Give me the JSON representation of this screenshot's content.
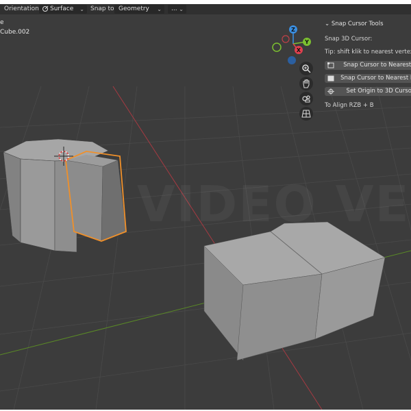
{
  "header": {
    "orientation_label": "Orientation:",
    "orientation_value": "Surface",
    "snap_label": "Snap to:",
    "snap_value": "Geometry",
    "extra_value": "..."
  },
  "viewport": {
    "object_info_1": "e",
    "object_info_2": "Cube.002",
    "watermark": "VIDEO VERSION"
  },
  "panel": {
    "title": "Snap Cursor Tools",
    "subtitle": "Snap 3D Cursor:",
    "tip": "Tip: shift klik to nearest vertex o",
    "buttons": [
      {
        "label": "Snap Cursor to Nearest V",
        "icon": "vertex-icon"
      },
      {
        "label": "Snap Cursor to Nearest Fac",
        "icon": "face-icon"
      },
      {
        "label": "Set Origin to 3D Cursor",
        "icon": "cursor-icon"
      }
    ],
    "footer": "To Align RZB + B"
  },
  "gizmo": {
    "x_label": "X",
    "y_label": "Y",
    "z_label": "Z"
  },
  "colors": {
    "viewport_bg": "#3c3c3c",
    "selection_outline": "#f0902a",
    "x_axis": "#e0404e",
    "y_axis": "#7cc030",
    "z_axis": "#3a8ee0"
  }
}
